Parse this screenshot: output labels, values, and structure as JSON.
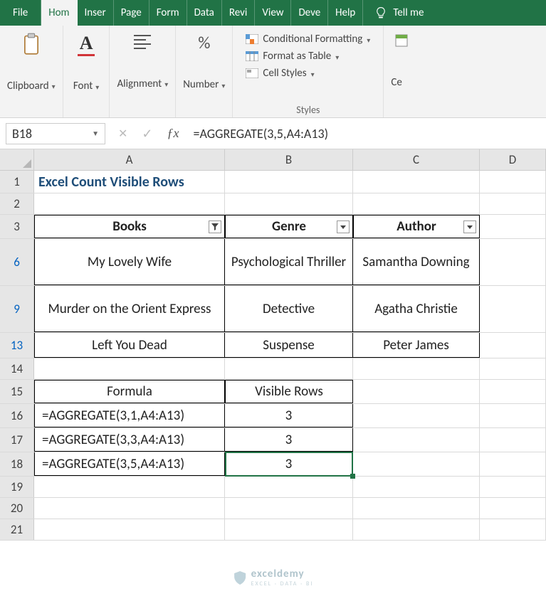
{
  "tabs": {
    "file": "File",
    "home": "Hom",
    "insert": "Inser",
    "page": "Page",
    "formulas": "Form",
    "data": "Data",
    "review": "Revi",
    "view": "View",
    "developer": "Deve",
    "help": "Help",
    "tellme": "Tell me"
  },
  "ribbon": {
    "clipboard": "Clipboard",
    "font": "Font",
    "alignment": "Alignment",
    "number": "Number",
    "styles": "Styles",
    "cond_format": "Conditional Formatting",
    "format_table": "Format as Table",
    "cell_styles": "Cell Styles",
    "cells_partial": "Ce"
  },
  "formula_bar": {
    "name_box": "B18",
    "formula": "=AGGREGATE(3,5,A4:A13)"
  },
  "columns": {
    "a": "A",
    "b": "B",
    "c": "C",
    "d": "D"
  },
  "rows": {
    "r1": "1",
    "r2": "2",
    "r3": "3",
    "r6": "6",
    "r9": "9",
    "r13": "13",
    "r14": "14",
    "r15": "15",
    "r16": "16",
    "r17": "17",
    "r18": "18",
    "r19": "19",
    "r20": "20",
    "r21": "21"
  },
  "sheet": {
    "title": "Excel Count Visible Rows",
    "headers": {
      "books": "Books",
      "genre": "Genre",
      "author": "Author"
    },
    "data": [
      {
        "book": "My Lovely Wife",
        "genre": "Psychological Thriller",
        "author": "Samantha Downing"
      },
      {
        "book": "Murder on the Orient Express",
        "genre": "Detective",
        "author": "Agatha Christie"
      },
      {
        "book": "Left You Dead",
        "genre": "Suspense",
        "author": "Peter James"
      }
    ],
    "results_hdr": {
      "formula": "Formula",
      "visible": "Visible Rows"
    },
    "results": [
      {
        "formula": "=AGGREGATE(3,1,A4:A13)",
        "value": "3"
      },
      {
        "formula": "=AGGREGATE(3,3,A4:A13)",
        "value": "3"
      },
      {
        "formula": "=AGGREGATE(3,5,A4:A13)",
        "value": "3"
      }
    ]
  },
  "watermark": {
    "name": "exceldemy",
    "sub": "EXCEL · DATA · BI"
  }
}
